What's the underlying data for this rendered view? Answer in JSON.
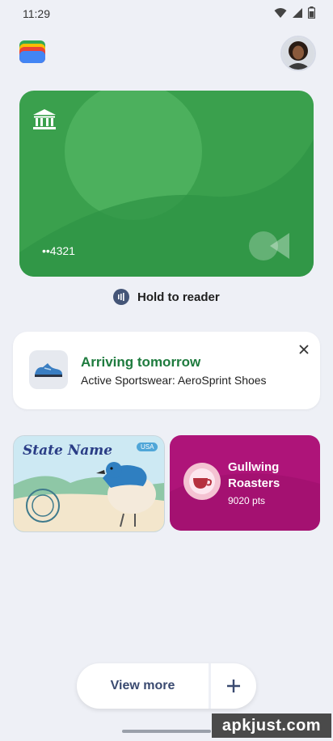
{
  "status_bar": {
    "time": "11:29",
    "icons": [
      "wifi-icon",
      "signal-icon",
      "battery-icon"
    ]
  },
  "header": {
    "logo_icon": "wallet-logo",
    "avatar_icon": "profile-avatar"
  },
  "bank_card": {
    "icon": "bank-icon",
    "number": "••4321",
    "color": "#3aa04d",
    "brand_icon": "card-network-logo"
  },
  "hold": {
    "icon": "nfc-icon",
    "label": "Hold to reader"
  },
  "delivery": {
    "icon": "shoe-thumbnail",
    "title": "Arriving tomorrow",
    "subtitle": "Active Sportswear: AeroSprint Shoes",
    "title_color": "#1e7b3e",
    "close_icon": "close-icon"
  },
  "id_card": {
    "title": "State Name",
    "badge": "USA",
    "illustration": "bluebird-illustration"
  },
  "loyalty_card": {
    "name": "Gullwing Roasters",
    "points": "9020 pts",
    "color": "#ae1479",
    "icon": "coffee-cup-icon"
  },
  "bottom_bar": {
    "view_more": "View more",
    "add_icon": "plus-icon"
  },
  "watermark": {
    "text": "apkjust.com"
  }
}
